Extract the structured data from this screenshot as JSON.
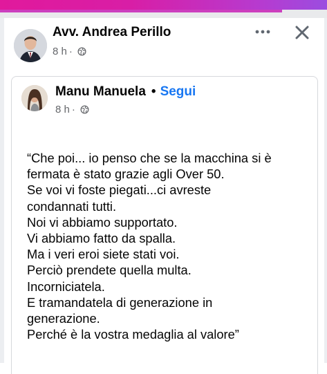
{
  "post": {
    "author": "Avv. Andrea Perillo",
    "time": "8 h",
    "meta_separator": "·",
    "more_icon": "more-horizontal-icon",
    "close_icon": "close-icon"
  },
  "shared_post": {
    "author": "Manu Manuela",
    "separator": "•",
    "follow_label": "Segui",
    "time": "8 h",
    "meta_separator": "·",
    "text_lines": [
      "“Che poi...  io penso che se la macchina si è",
      "fermata è stato grazie agli Over 50.",
      "Se voi vi foste piegati...ci avreste",
      "condannati tutti.",
      "Noi vi abbiamo supportato.",
      "Vi abbiamo fatto da spalla.",
      "Ma i veri eroi siete stati voi.",
      "Perciò prendete quella multa.",
      "Incorniciatela.",
      "E tramandatela di generazione in",
      "generazione.",
      "Perché è la vostra medaglia al valore”"
    ]
  },
  "colors": {
    "accent_pink": "#d81ea6",
    "link_blue": "#1877f2",
    "meta_gray": "#65676b"
  }
}
